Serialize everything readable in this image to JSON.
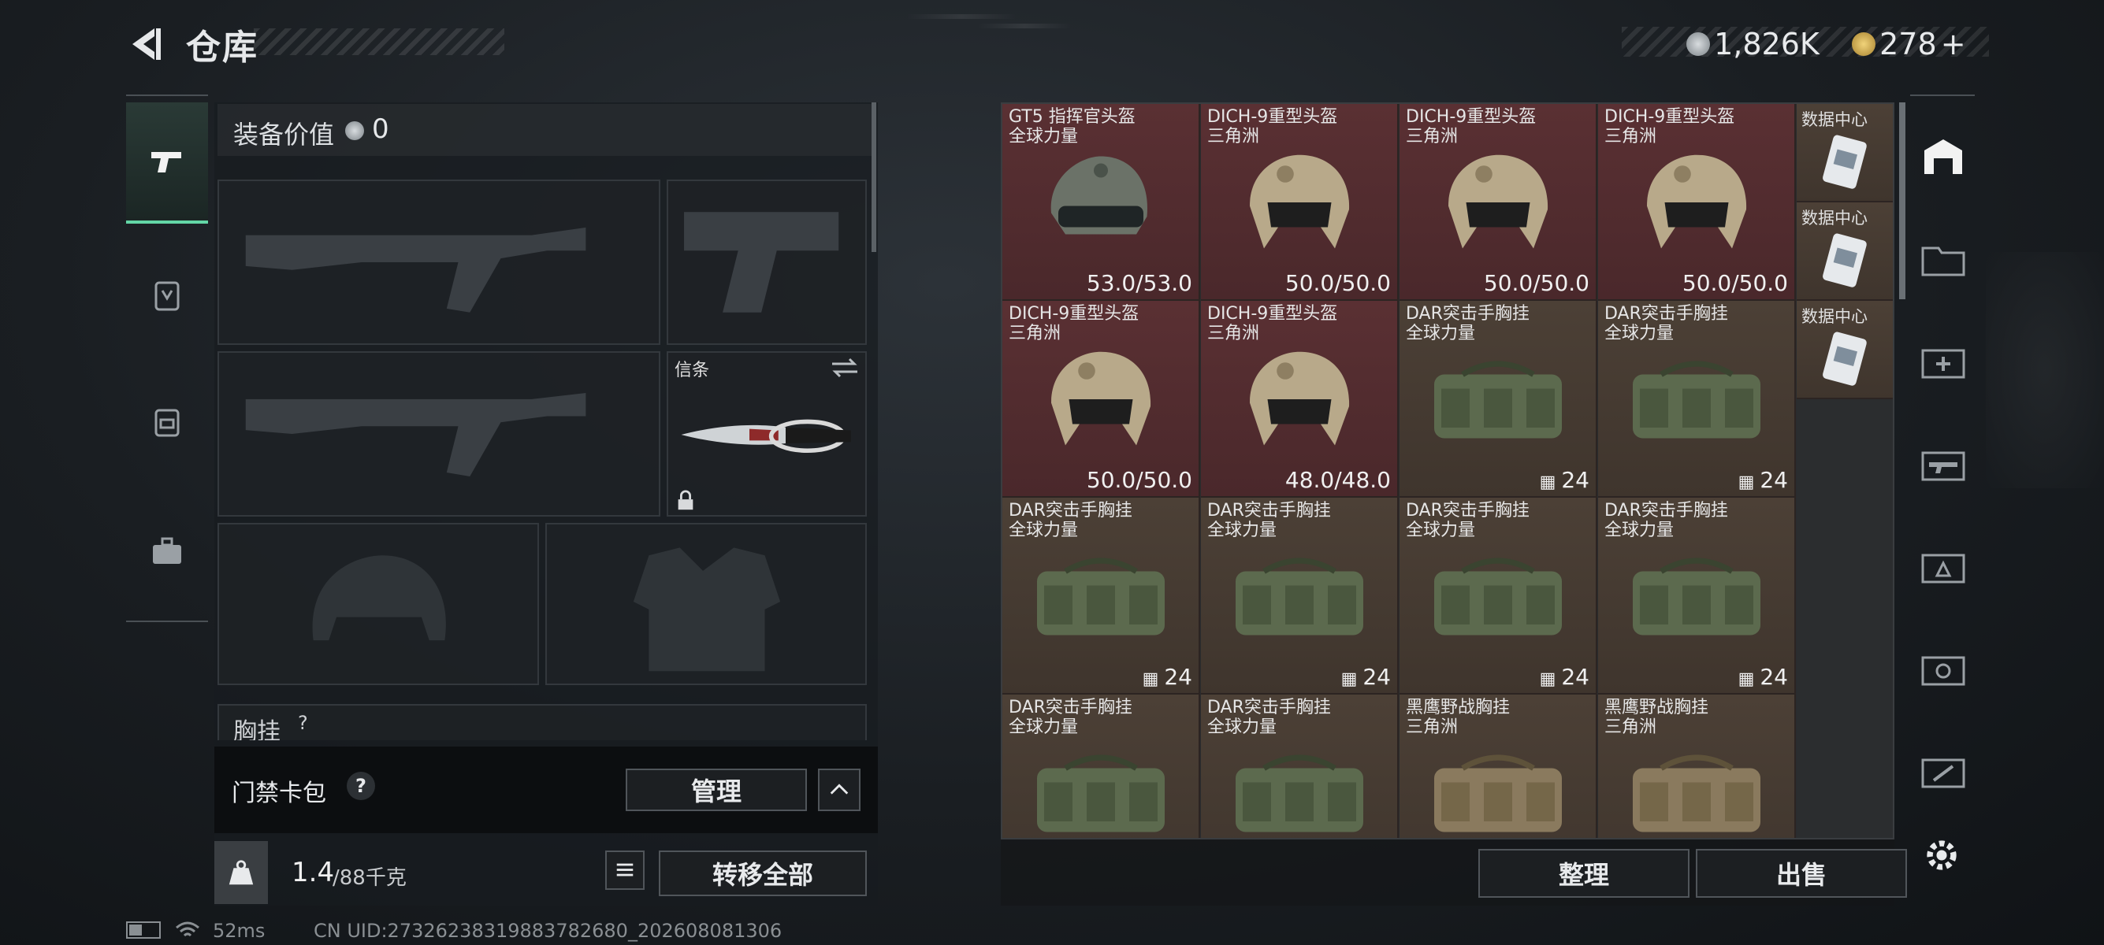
{
  "header": {
    "title": "仓库",
    "currency_silver": "1,826K",
    "currency_gold": "278",
    "gold_plus": "+"
  },
  "equipment": {
    "value_label": "装备价值",
    "value": "0",
    "letter_slot_label": "信条",
    "chest_rig_label": "胸挂",
    "chest_rig_hint": "?"
  },
  "keycard": {
    "label": "门禁卡包",
    "help": "?",
    "manage_button": "管理"
  },
  "weight": {
    "current": "1.4",
    "max": "/88千克",
    "transfer_all": "转移全部"
  },
  "stash": {
    "items": [
      {
        "name": "GT5 指挥官头盔",
        "sub": "全球力量",
        "value": "53.0/53.0",
        "kind": "helmet-black",
        "bg": "red"
      },
      {
        "name": "DICH-9重型头盔",
        "sub": "三角洲",
        "value": "50.0/50.0",
        "kind": "helmet-tan",
        "bg": "red"
      },
      {
        "name": "DICH-9重型头盔",
        "sub": "三角洲",
        "value": "50.0/50.0",
        "kind": "helmet-tan",
        "bg": "red"
      },
      {
        "name": "DICH-9重型头盔",
        "sub": "三角洲",
        "value": "50.0/50.0",
        "kind": "helmet-tan",
        "bg": "red"
      },
      {
        "name": "DICH-9重型头盔",
        "sub": "三角洲",
        "value": "50.0/50.0",
        "kind": "helmet-tan",
        "bg": "red"
      },
      {
        "name": "DICH-9重型头盔",
        "sub": "三角洲",
        "value": "48.0/48.0",
        "kind": "helmet-tan",
        "bg": "red"
      },
      {
        "name": "DAR突击手胸挂",
        "sub": "全球力量",
        "value": "24",
        "kind": "rig-green",
        "bg": "brown"
      },
      {
        "name": "DAR突击手胸挂",
        "sub": "全球力量",
        "value": "24",
        "kind": "rig-green",
        "bg": "brown"
      },
      {
        "name": "DAR突击手胸挂",
        "sub": "全球力量",
        "value": "24",
        "kind": "rig-green",
        "bg": "brown"
      },
      {
        "name": "DAR突击手胸挂",
        "sub": "全球力量",
        "value": "24",
        "kind": "rig-green",
        "bg": "brown"
      },
      {
        "name": "DAR突击手胸挂",
        "sub": "全球力量",
        "value": "24",
        "kind": "rig-green",
        "bg": "brown"
      },
      {
        "name": "DAR突击手胸挂",
        "sub": "全球力量",
        "value": "24",
        "kind": "rig-green",
        "bg": "brown"
      },
      {
        "name": "DAR突击手胸挂",
        "sub": "全球力量",
        "value": "",
        "kind": "rig-green",
        "bg": "brown"
      },
      {
        "name": "DAR突击手胸挂",
        "sub": "全球力量",
        "value": "",
        "kind": "rig-green",
        "bg": "brown"
      },
      {
        "name": "黑鹰野战胸挂",
        "sub": "三角洲",
        "value": "",
        "kind": "rig-tan",
        "bg": "brown"
      },
      {
        "name": "黑鹰野战胸挂",
        "sub": "三角洲",
        "value": "",
        "kind": "rig-tan",
        "bg": "brown"
      }
    ],
    "small_items": [
      {
        "name": "数据中心"
      },
      {
        "name": "数据中心"
      },
      {
        "name": "数据中心"
      }
    ],
    "sort_button": "整理",
    "sell_button": "出售"
  },
  "status": {
    "ping": "52ms",
    "uid": "CN UID:27326238319883782680_202608081306"
  }
}
